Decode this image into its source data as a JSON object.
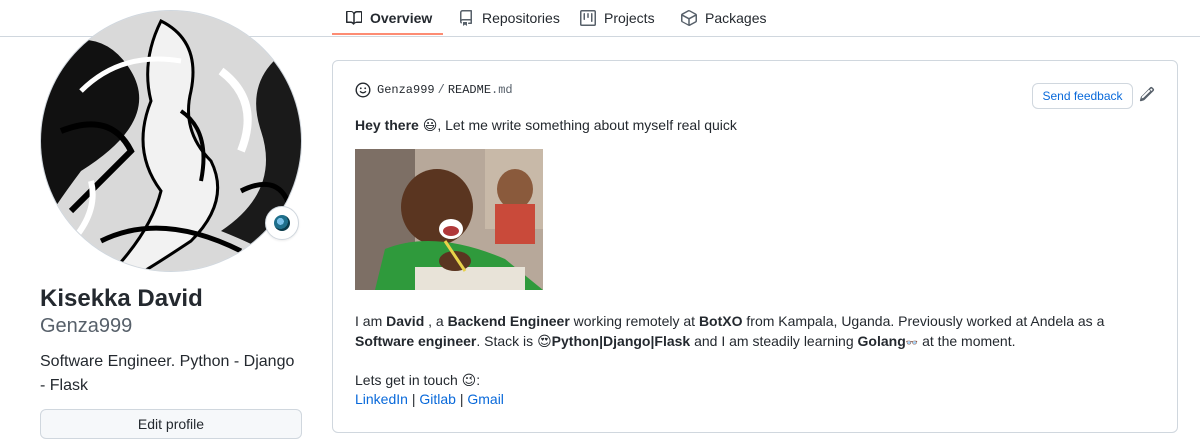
{
  "tabs": [
    {
      "label": "Overview",
      "icon": "book-icon",
      "active": true
    },
    {
      "label": "Repositories",
      "icon": "repo-icon",
      "active": false
    },
    {
      "label": "Projects",
      "icon": "project-icon",
      "active": false
    },
    {
      "label": "Packages",
      "icon": "package-icon",
      "active": false
    }
  ],
  "profile": {
    "full_name": "Kisekka David",
    "username": "Genza999",
    "bio": "Software Engineer. Python - Django - Flask",
    "edit_button": "Edit profile"
  },
  "readme": {
    "owner": "Genza999",
    "separator": "/",
    "file_base": "README",
    "file_ext": ".md",
    "feedback_button": "Send feedback",
    "greeting_bold": "Hey there",
    "greeting_emoji": "😃",
    "greeting_rest": ", Let me write something about myself real quick",
    "intro": {
      "t1": "I am ",
      "name": "David",
      "t2": " , a ",
      "role": "Backend Engineer",
      "t3": " working remotely at ",
      "company": "BotXO",
      "t4": " from Kampala, Uganda. Previously worked at Andela as a ",
      "prev_role": "Software engineer",
      "t5": ". Stack is ",
      "stack_emoji": "😍",
      "stack": "Python|Django|Flask",
      "t6": " and I am steadily learning ",
      "learning": "Golang",
      "learning_emoji": "👓",
      "t7": " at the moment."
    },
    "contact_text": "Lets get in touch",
    "contact_emoji": "😉",
    "contact_colon": ":",
    "links": [
      "LinkedIn",
      "Gitlab",
      "Gmail"
    ],
    "link_separator": "|"
  },
  "colors": {
    "accent_underline": "#fd8c73",
    "link": "#0969da",
    "border": "#d0d7de"
  }
}
